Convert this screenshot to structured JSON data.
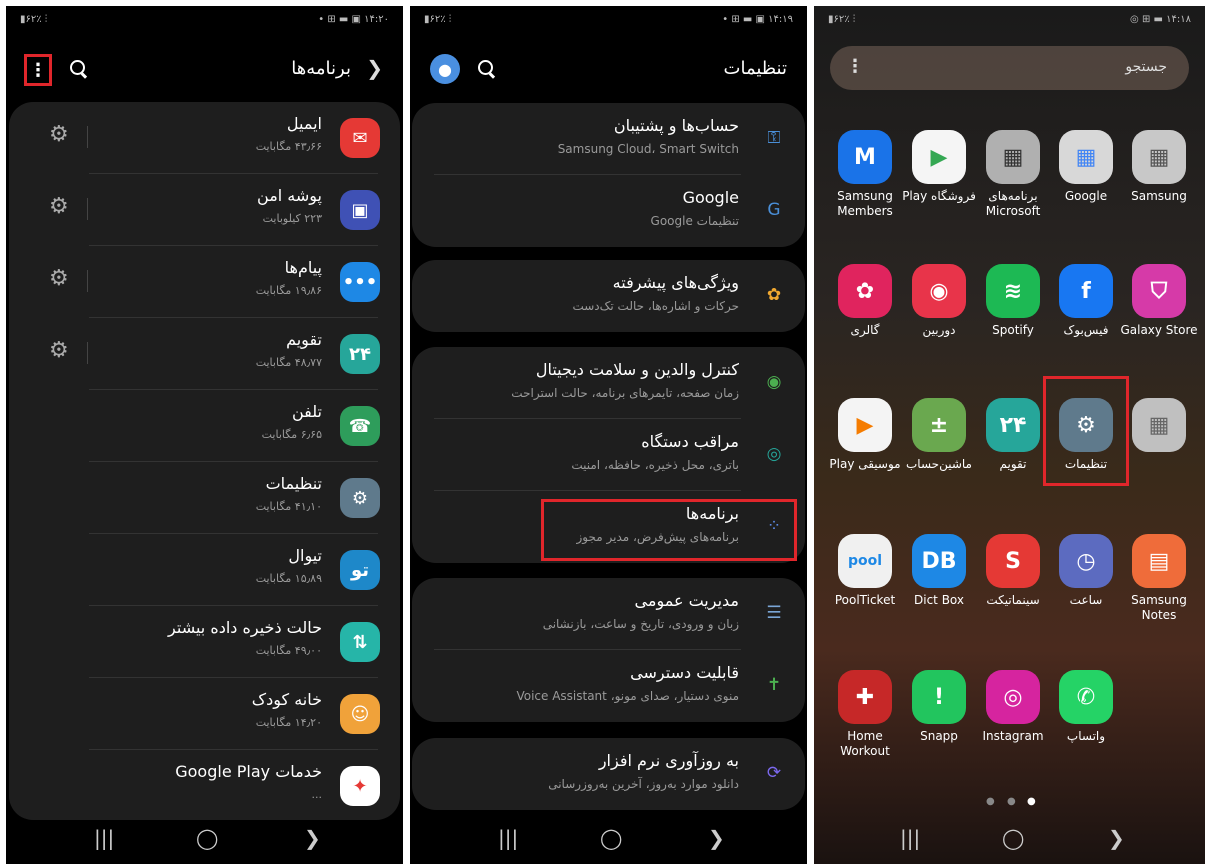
{
  "status": {
    "p1_left": "▮۶۲٪ ⫶",
    "p1_right": "• ⊞ ▬ ▣ ۱۴:۲۰",
    "p2_left": "▮۶۲٪ ⫶",
    "p2_right": "• ⊞ ▬ ▣ ۱۴:۱۹",
    "p3_left": "▮۶۲٪ ⫶",
    "p3_right": "◎ ⊞ ▬ ۱۴:۱۸"
  },
  "apps_screen": {
    "title": "برنامه‌ها",
    "items": [
      {
        "name": "ایمیل",
        "size": "۴۳٫۶۶ مگابایت",
        "color": "#e53935",
        "glyph": "✉",
        "gear": true
      },
      {
        "name": "پوشه امن",
        "size": "۲۲۳ کیلوبایت",
        "color": "#3f51b5",
        "glyph": "▣",
        "gear": true
      },
      {
        "name": "پیام‌ها",
        "size": "۱۹٫۸۶ مگابایت",
        "color": "#1e88e5",
        "glyph": "•••",
        "gear": true
      },
      {
        "name": "تقویم",
        "size": "۴۸٫۷۷ مگابایت",
        "color": "#26a69a",
        "glyph": "۲۴",
        "gear": true
      },
      {
        "name": "تلفن",
        "size": "۶٫۶۵ مگابایت",
        "color": "#2e9d5b",
        "glyph": "☎",
        "gear": false
      },
      {
        "name": "تنظیمات",
        "size": "۴۱٫۱۰ مگابایت",
        "color": "#5f7a8c",
        "glyph": "⚙",
        "gear": false
      },
      {
        "name": "تیوال",
        "size": "۱۵٫۸۹ مگابایت",
        "color": "#1e88c9",
        "glyph": "تو",
        "gear": false
      },
      {
        "name": "حالت ذخیره داده بیشتر",
        "size": "۴۹٫۰۰ مگابایت",
        "color": "#26b5a8",
        "glyph": "⇅",
        "gear": false
      },
      {
        "name": "خانه کودک",
        "size": "۱۴٫۲۰ مگابایت",
        "color": "#f0a23a",
        "glyph": "☺",
        "gear": false
      },
      {
        "name": "خدمات Google Play",
        "size": "...",
        "color": "#ffffff",
        "glyph": "✦",
        "gear": false
      }
    ]
  },
  "settings_screen": {
    "title": "تنظیمات",
    "items": [
      {
        "name": "حساب‌ها و پشتیبان",
        "sub": "Samsung Cloud، Smart Switch",
        "icon": "⚿",
        "color": "#4a8fd8"
      },
      {
        "name": "Google",
        "sub": "تنظیمات Google",
        "icon": "G",
        "color": "#4a8fd8"
      },
      {
        "name": "ویژگی‌های پیشرفته",
        "sub": "حرکات و اشاره‌ها، حالت تک‌دست",
        "icon": "✿",
        "color": "#f0a830"
      },
      {
        "name": "کنترل والدین و سلامت دیجیتال",
        "sub": "زمان صفحه، تایمرهای برنامه، حالت استراحت",
        "icon": "◉",
        "color": "#4caf50"
      },
      {
        "name": "مراقب دستگاه",
        "sub": "باتری، محل ذخیره، حافظه، امنیت",
        "icon": "◎",
        "color": "#26a69a"
      },
      {
        "name": "برنامه‌ها",
        "sub": "برنامه‌های پیش‌فرض، مدیر مجوز",
        "icon": "⁘",
        "color": "#5c8ae6"
      },
      {
        "name": "مدیریت عمومی",
        "sub": "زبان و ورودی، تاریخ و ساعت، بازنشانی",
        "icon": "☰",
        "color": "#7aa6d6"
      },
      {
        "name": "قابلیت دسترسی",
        "sub": "منوی دستیار، صدای مونو، Voice Assistant",
        "icon": "✝",
        "color": "#4caf50"
      },
      {
        "name": "به روزآوری نرم افزار",
        "sub": "دانلود موارد به‌روز، آخرین به‌روزرسانی",
        "icon": "⟳",
        "color": "#7b68ee"
      }
    ]
  },
  "home_screen": {
    "search_placeholder": "جستجو",
    "apps": [
      {
        "label": "Samsung Members",
        "color": "#1a73e8",
        "glyph": "M"
      },
      {
        "label": "Play فروشگاه",
        "color": "#f5f5f5",
        "glyph": "▶"
      },
      {
        "label": "برنامه‌های Microsoft",
        "color": "#b0b0b0",
        "glyph": "▦"
      },
      {
        "label": "Google",
        "color": "#d8d8d8",
        "glyph": "▦"
      },
      {
        "label": "Samsung",
        "color": "#c8c8c8",
        "glyph": "▦"
      },
      {
        "label": "گالری",
        "color": "#e0245e",
        "glyph": "✿"
      },
      {
        "label": "دوربین",
        "color": "#e8344a",
        "glyph": "◉"
      },
      {
        "label": "Spotify",
        "color": "#1db954",
        "glyph": "≋"
      },
      {
        "label": "فیس‌بوک",
        "color": "#1877f2",
        "glyph": "f"
      },
      {
        "label": "Galaxy Store",
        "color": "#d63aa8",
        "glyph": "⛉"
      },
      {
        "label": "Play موسیقی",
        "color": "#f4f4f4",
        "glyph": "▶"
      },
      {
        "label": "ماشین‌حساب",
        "color": "#6aa84f",
        "glyph": "±"
      },
      {
        "label": "تقویم",
        "color": "#26a69a",
        "glyph": "۲۴"
      },
      {
        "label": "تنظیمات",
        "color": "#5f7a8c",
        "glyph": "⚙"
      },
      {
        "label": "",
        "color": "#c0c0c0",
        "glyph": "▦"
      },
      {
        "label": "PoolTicket",
        "color": "#f0f0f0",
        "glyph": "pool"
      },
      {
        "label": "Dict Box",
        "color": "#1e88e5",
        "glyph": "DB"
      },
      {
        "label": "سینماتیکت",
        "color": "#e53935",
        "glyph": "S"
      },
      {
        "label": "ساعت",
        "color": "#5c6bc0",
        "glyph": "◷"
      },
      {
        "label": "Samsung Notes",
        "color": "#ef6c3a",
        "glyph": "▤"
      },
      {
        "label": "Home Workout",
        "color": "#c62828",
        "glyph": "✚"
      },
      {
        "label": "Snapp",
        "color": "#22c55e",
        "glyph": "!"
      },
      {
        "label": "Instagram",
        "color": "#d6249f",
        "glyph": "◎"
      },
      {
        "label": "واتساپ",
        "color": "#25d366",
        "glyph": "✆"
      }
    ]
  },
  "nav": {
    "recents": "|||",
    "home": "◯",
    "back": "❯"
  },
  "colors": {
    "highlight": "#e0262b"
  }
}
